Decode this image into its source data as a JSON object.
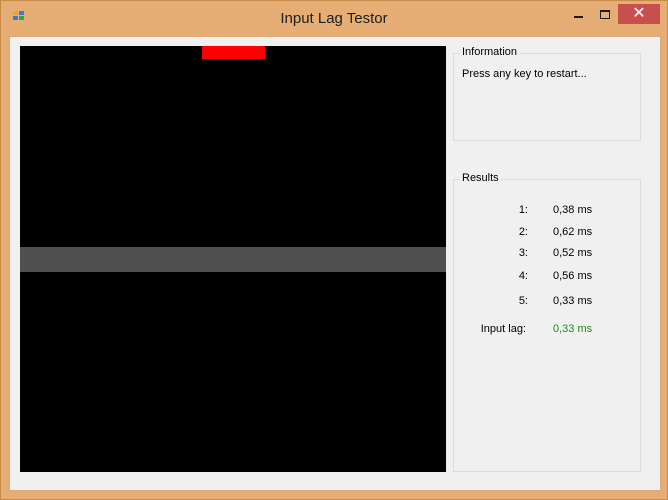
{
  "window": {
    "title": "Input Lag Testor"
  },
  "titlebar": {
    "minimize_icon": "minimize-icon",
    "maximize_icon": "maximize-icon",
    "close_glyph": "✕"
  },
  "canvas": {
    "marker_color": "#ff0000",
    "band_color": "#505050",
    "background": "#000000"
  },
  "information": {
    "legend": "Information",
    "message": "Press any key to restart..."
  },
  "results": {
    "legend": "Results",
    "rows": [
      {
        "label": "1:",
        "value": "0,38 ms"
      },
      {
        "label": "2:",
        "value": "0,62 ms"
      },
      {
        "label": "3:",
        "value": "0,52 ms"
      },
      {
        "label": "4:",
        "value": "0,56 ms"
      },
      {
        "label": "5:",
        "value": "0,33 ms"
      }
    ],
    "input_lag": {
      "label": "Input lag:",
      "value": "0,33 ms",
      "color": "#1e8a1e"
    }
  }
}
